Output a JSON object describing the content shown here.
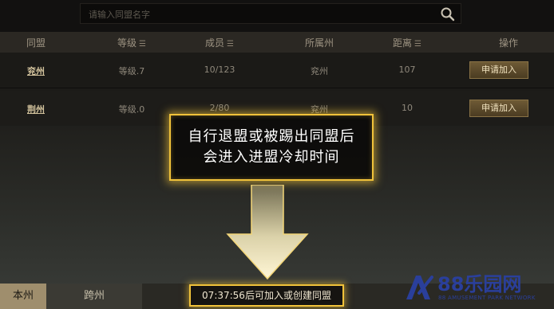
{
  "search": {
    "placeholder": "请输入同盟名字"
  },
  "table": {
    "headers": [
      "同盟",
      "等级",
      "成员",
      "所属州",
      "距离",
      "操作"
    ],
    "rows": [
      {
        "name": "兖州",
        "level": "等级.7",
        "members": "10/123",
        "province": "兖州",
        "distance": "107",
        "action": "申请加入"
      },
      {
        "name": "荆州",
        "level": "等级.0",
        "members": "2/80",
        "province": "兖州",
        "distance": "10",
        "action": "申请加入"
      }
    ]
  },
  "callout": {
    "line1": "自行退盟或被踢出同盟后",
    "line2": "会进入进盟冷却时间"
  },
  "tabs": [
    "本州",
    "跨州"
  ],
  "cooldown": {
    "text": "07:37:56后可加入或创建同盟"
  },
  "watermark": {
    "name": "88乐园网",
    "sub": "88 AMUSEMENT PARK NETWORK"
  },
  "colors": {
    "highlight": "#f0c23a",
    "button": "#6e5a35"
  }
}
